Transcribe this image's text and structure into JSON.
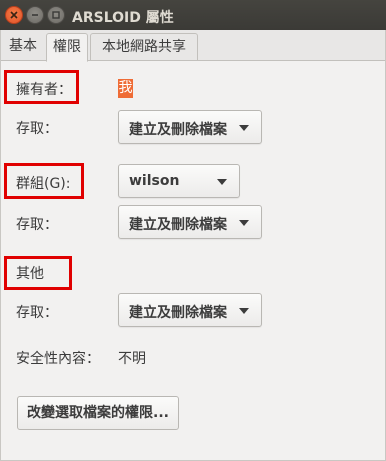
{
  "window": {
    "title": "ARSLOID 屬性",
    "controls": {
      "close": "close-icon",
      "minimize": "minimize-icon",
      "maximize": "maximize-icon"
    }
  },
  "tabs": [
    {
      "label": "基本",
      "active": false
    },
    {
      "label": "權限",
      "active": true
    },
    {
      "label": "本地網路共享",
      "active": false
    }
  ],
  "permissions": {
    "owner": {
      "label": "擁有者：",
      "value": "我",
      "access_label": "存取：",
      "access_value": "建立及刪除檔案"
    },
    "group": {
      "label": "群組(G):",
      "value": "wilson",
      "access_label": "存取：",
      "access_value": "建立及刪除檔案"
    },
    "others": {
      "label": "其他",
      "access_label": "存取：",
      "access_value": "建立及刪除檔案"
    },
    "security_context": {
      "label": "安全性內容：",
      "value": "不明"
    },
    "change_button": "改變選取檔案的權限..."
  },
  "colors": {
    "highlight": "#e00000",
    "accent": "#ef6c36",
    "titlebar": "#3b3a36"
  }
}
